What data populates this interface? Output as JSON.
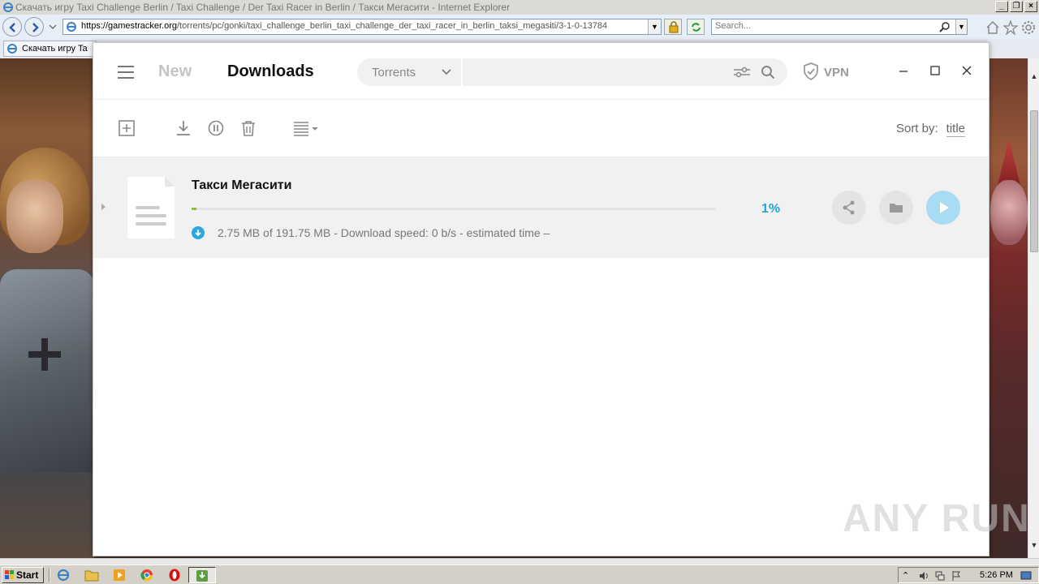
{
  "browser": {
    "title": "Скачать игру Taxi Challenge Berlin / Taxi Challenge / Der Taxi Racer in Berlin / Такси Мегасити - Internet Explorer",
    "window_buttons": [
      "_",
      "❐",
      "×"
    ],
    "address": {
      "host": "https://gamestracker.org",
      "path": "/torrents/pc/gonki/taxi_challenge_berlin_taxi_challenge_der_taxi_racer_in_berlin_taksi_megasiti/3-1-0-13784"
    },
    "search_placeholder": "Search...",
    "tab_label": "Скачать игру Ta"
  },
  "app": {
    "tabs": {
      "new": "New",
      "downloads": "Downloads"
    },
    "search": {
      "category": "Torrents",
      "value": ""
    },
    "vpn_label": "VPN",
    "sort_label": "Sort by:",
    "sort_value": "title",
    "downloads": [
      {
        "title": "Такси Мегасити",
        "progress_fraction": 0.01,
        "percent_label": "1%",
        "status": "2.75 MB of 191.75 MB - Download speed: 0 b/s - estimated time –"
      }
    ]
  },
  "watermark": "ANY  RUN",
  "taskbar": {
    "start_label": "Start",
    "clock": "5:26 PM"
  },
  "colors": {
    "accent": "#21a6d8",
    "progress": "#8cbd3c",
    "play_button": "#a8dcf2"
  }
}
